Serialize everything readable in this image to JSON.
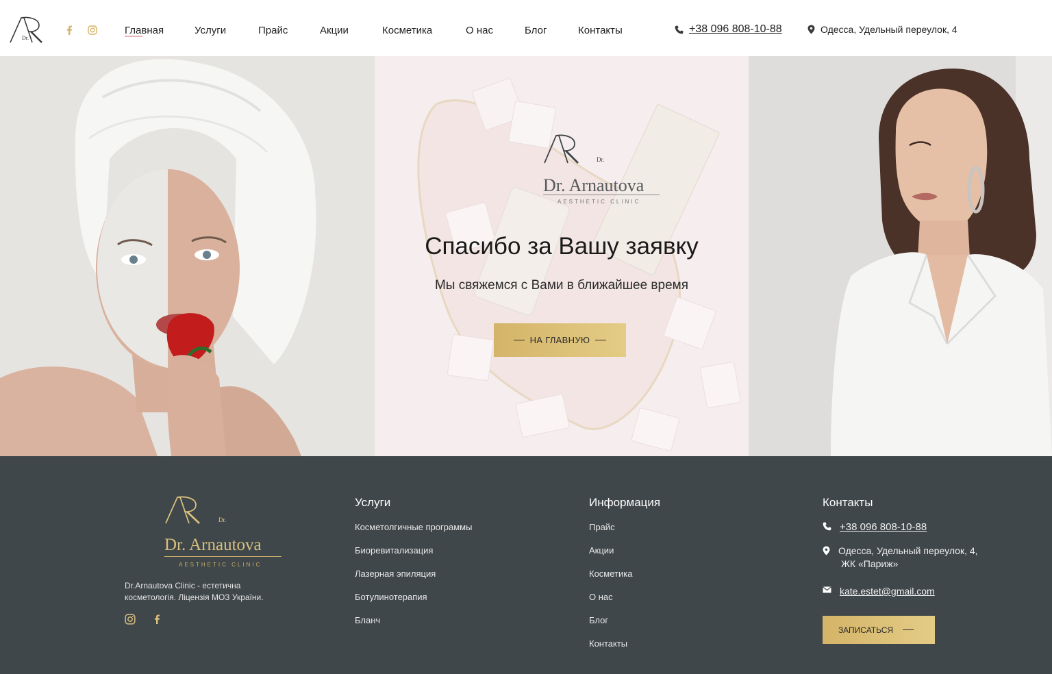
{
  "header": {
    "logo_dr": "Dr.",
    "nav": [
      {
        "label": "Главная",
        "active": true
      },
      {
        "label": "Услуги"
      },
      {
        "label": "Прайс"
      },
      {
        "label": "Акции"
      },
      {
        "label": "Косметика"
      },
      {
        "label": "О нас"
      },
      {
        "label": "Блог"
      },
      {
        "label": "Контакты"
      }
    ],
    "phone": "+38 096 808-10-88",
    "address": "Одесса, Удельный переулок, 4",
    "icons": {
      "facebook": "facebook-icon",
      "instagram": "instagram-icon",
      "phone": "phone-icon",
      "location": "location-pin-icon"
    }
  },
  "hero": {
    "brand_dr": "Dr.",
    "brand_name": "Dr. Arnautova",
    "brand_sub": "AESTHETIC CLINIC",
    "title": "Спасибо за Вашу заявку",
    "subtitle": "Мы свяжемся с Вами в ближайшее время",
    "button_label": "НА ГЛАВНУЮ"
  },
  "footer": {
    "brand_dr": "Dr.",
    "brand_name": "Dr. Arnautova",
    "brand_sub": "AESTHETIC CLINIC",
    "description": "Dr.Arnautova Clinic - естетична косметологія. Ліцензія МОЗ України.",
    "services": {
      "heading": "Услуги",
      "items": [
        "Косметолгичные программы",
        "Биоревитализация",
        "Лазерная эпиляция",
        "Ботулинотерапия",
        "Бланч"
      ]
    },
    "info": {
      "heading": "Информация",
      "items": [
        "Прайс",
        "Акции",
        "Косметика",
        "О нас",
        "Блог",
        "Контакты"
      ]
    },
    "contacts": {
      "heading": "Контакты",
      "phone": "+38 096 808-10-88",
      "address_line1": "Одесса, Удельный переулок, 4,",
      "address_line2": "ЖК «Париж»",
      "email": "kate.estet@gmail.com",
      "button_label": "ЗАПИСАТЬСЯ"
    }
  },
  "colors": {
    "gold": "#d4b468",
    "footer_bg": "#3f474a",
    "hero_mid_bg": "#f7eef0",
    "nav_active_underline": "#e5b4b4"
  }
}
